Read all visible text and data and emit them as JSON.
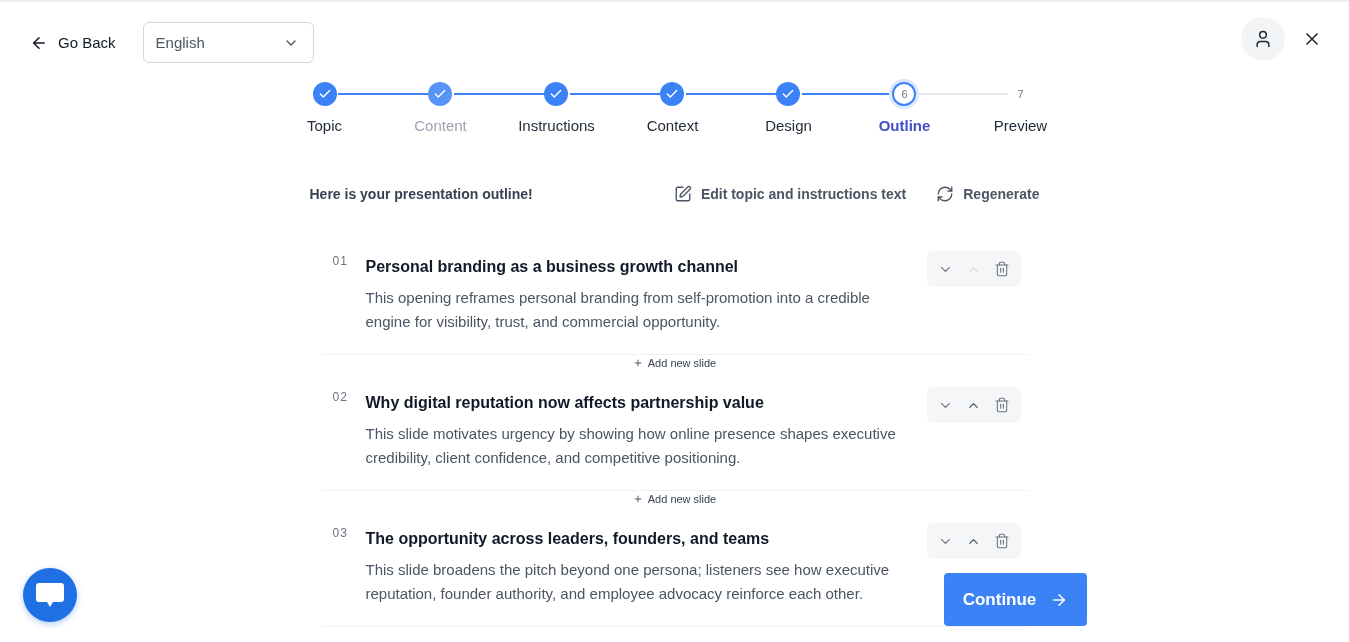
{
  "header": {
    "back_button": {
      "label": "Go Back"
    },
    "language_select": {
      "value": "English"
    }
  },
  "stepper": {
    "steps": [
      {
        "label": "Topic",
        "completed": true,
        "selected": false,
        "dimmed": false
      },
      {
        "label": "Content",
        "completed": true,
        "selected": false,
        "dimmed": true
      },
      {
        "label": "Instructions",
        "completed": true,
        "selected": false,
        "dimmed": false
      },
      {
        "label": "Context",
        "completed": true,
        "selected": false,
        "dimmed": false
      },
      {
        "label": "Design",
        "completed": true,
        "selected": false,
        "dimmed": false
      },
      {
        "label": "Outline",
        "number": "6",
        "completed": false,
        "selected": true,
        "dimmed": false
      },
      {
        "label": "Preview",
        "number": "7",
        "completed": false,
        "selected": false,
        "dimmed": false
      }
    ]
  },
  "outline": {
    "heading": "Here is your presentation outline!",
    "actions": [
      {
        "kind": "edit",
        "label": "Edit topic and instructions text"
      },
      {
        "kind": "regenerate",
        "label": "Regenerate"
      }
    ],
    "slides": [
      {
        "number": "01",
        "title": "Personal branding as a business growth channel",
        "description": "This opening reframes personal branding from self-promotion into a credible engine for visibility, trust, and commercial opportunity.",
        "up_disabled": true
      },
      {
        "number": "02",
        "title": "Why digital reputation now affects partnership value",
        "description": "This slide motivates urgency by showing how online presence shapes executive credibility, client confidence, and competitive positioning.",
        "up_disabled": false
      },
      {
        "number": "03",
        "title": "The opportunity across leaders, founders, and teams",
        "description": "This slide broadens the pitch beyond one persona; listeners see how executive reputation, founder authority, and employee advocacy reinforce each other.",
        "up_disabled": false
      }
    ],
    "add_slide_buttons": [
      {
        "label": "Add new slide"
      },
      {
        "label": "Add new slide"
      }
    ]
  },
  "continue_button": {
    "label": "Continue"
  }
}
